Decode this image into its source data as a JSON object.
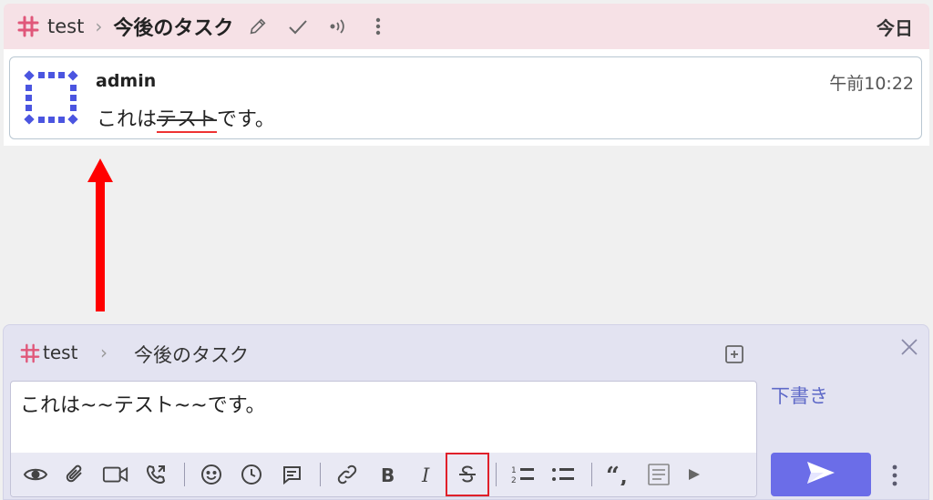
{
  "header": {
    "channel": "test",
    "separator": "›",
    "topic": "今後のタスク",
    "date": "今日"
  },
  "message": {
    "author": "admin",
    "time": "午前10:22",
    "text_before": "これは",
    "text_strike": "テスト",
    "text_after": "です。"
  },
  "composer": {
    "channel": "test",
    "separator": "›",
    "topic": "今後のタスク",
    "draft_label": "下書き",
    "input_text": "これは~~テスト~~です。"
  },
  "colors": {
    "accent": "#6b6de8",
    "hash": "#e0577a",
    "highlight": "#e0202a",
    "arrow": "#ff0000"
  }
}
